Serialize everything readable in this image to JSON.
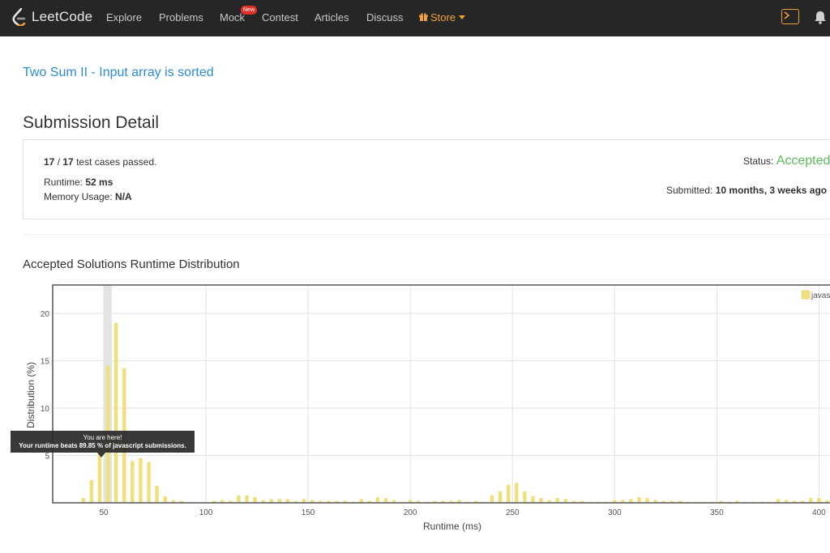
{
  "nav": {
    "brand": "LeetCode",
    "items": [
      "Explore",
      "Problems",
      "Mock",
      "Contest",
      "Articles",
      "Discuss"
    ],
    "new_badge": "New",
    "store": "Store"
  },
  "problem_title": "Two Sum II - Input array is sorted",
  "detail": {
    "section_title": "Submission Detail",
    "tests_passed": "17",
    "tests_total": "17",
    "tests_suffix": "test cases passed.",
    "runtime_label": "Runtime:",
    "runtime_value": "52 ms",
    "memory_label": "Memory Usage:",
    "memory_value": "N/A",
    "status_label": "Status:",
    "status_value": "Accepted",
    "submitted_label": "Submitted:",
    "submitted_value": "10 months, 3 weeks ago"
  },
  "chart_data": {
    "type": "bar",
    "title": "Accepted Solutions Runtime Distribution",
    "xlabel": "Runtime (ms)",
    "ylabel": "Distribution (%)",
    "xlim": [
      25,
      405
    ],
    "ylim": [
      0,
      23
    ],
    "x_ticks": [
      50,
      100,
      150,
      200,
      250,
      300,
      350,
      400
    ],
    "y_ticks": [
      5,
      10,
      15,
      20
    ],
    "legend": "javascript",
    "bar_color": "#f0e07a",
    "highlight_x": 52,
    "x": [
      40,
      44,
      48,
      52,
      56,
      60,
      64,
      68,
      72,
      76,
      80,
      84,
      88,
      104,
      108,
      112,
      116,
      120,
      124,
      128,
      132,
      136,
      140,
      144,
      148,
      152,
      156,
      160,
      164,
      168,
      172,
      176,
      180,
      184,
      188,
      192,
      196,
      200,
      204,
      208,
      212,
      216,
      220,
      224,
      228,
      232,
      236,
      240,
      244,
      248,
      252,
      256,
      260,
      264,
      268,
      272,
      276,
      280,
      284,
      288,
      292,
      296,
      300,
      304,
      308,
      312,
      316,
      320,
      324,
      328,
      332,
      336,
      340,
      344,
      348,
      352,
      356,
      360,
      364,
      368,
      372,
      376,
      380,
      384,
      388,
      392,
      396,
      400,
      404
    ],
    "values": [
      0.5,
      2.4,
      5.8,
      14.5,
      19.0,
      14.2,
      4.4,
      4.7,
      4.3,
      1.8,
      0.7,
      0.3,
      0.2,
      0.2,
      0.3,
      0.2,
      0.8,
      0.8,
      0.6,
      0.3,
      0.4,
      0.4,
      0.4,
      0.2,
      0.4,
      0.3,
      0.2,
      0.2,
      0.2,
      0.2,
      0.1,
      0.4,
      0.2,
      0.6,
      0.5,
      0.3,
      0.1,
      0.3,
      0.2,
      0.1,
      0.2,
      0.2,
      0.2,
      0.3,
      0.1,
      0.2,
      0.1,
      0.8,
      1.2,
      1.9,
      2.1,
      1.2,
      0.7,
      0.5,
      0.3,
      0.5,
      0.4,
      0.2,
      0.2,
      0.1,
      0.1,
      0.1,
      0.3,
      0.3,
      0.4,
      0.6,
      0.5,
      0.3,
      0.2,
      0.2,
      0.2,
      0.1,
      0.1,
      0.1,
      0.1,
      0.2,
      0.1,
      0.2,
      0.1,
      0.1,
      0.1,
      0.1,
      0.4,
      0.3,
      0.2,
      0.2,
      0.5,
      0.5,
      0.3
    ]
  },
  "tooltip": {
    "line1": "You are here!",
    "line2": "Your runtime beats 89.85 % of javascript submissions."
  }
}
